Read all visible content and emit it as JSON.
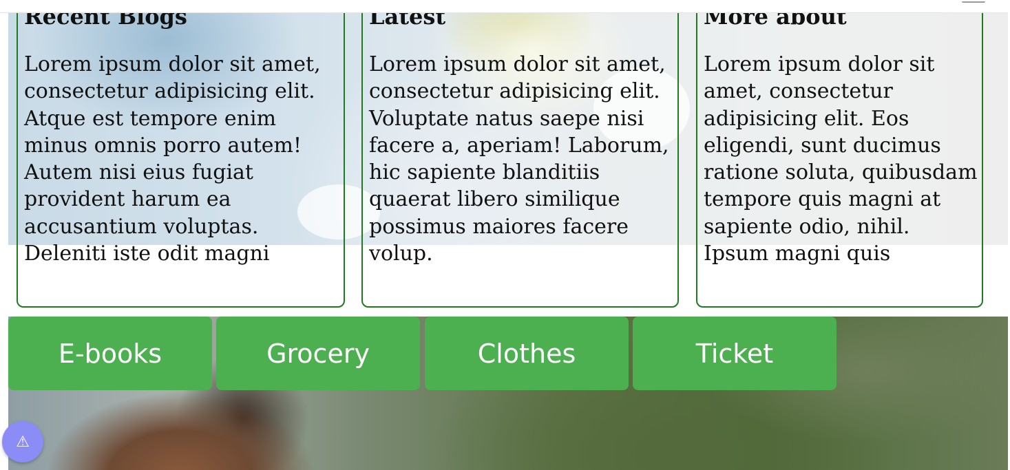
{
  "blogs": [
    {
      "title": "Recent Blogs",
      "text": "Lorem ipsum dolor sit amet, consectetur adipisicing elit. Atque est tempore enim minus omnis porro autem! Autem nisi eius fugiat provident harum ea accusantium voluptas. Deleniti iste odit magni"
    },
    {
      "title": "Latest",
      "text": "Lorem ipsum dolor sit amet, consectetur adipisicing elit. Voluptate natus saepe nisi facere a, aperiam! Laborum, hic sapiente blanditiis quaerat libero similique possimus maiores facere volup."
    },
    {
      "title": "More about",
      "text": "Lorem ipsum dolor sit amet, consectetur adipisicing elit. Eos eligendi, sunt ducimus ratione soluta, quibusdam tempore quis magni at sapiente odio, nihil. Ipsum magni quis"
    }
  ],
  "nav": {
    "buttons": [
      "E-books",
      "Grocery",
      "Clothes",
      "Ticket"
    ]
  },
  "fab": {
    "icon": "warning-icon",
    "glyph": "⚠"
  },
  "colors": {
    "card_border": "#1f7a1f",
    "button_bg": "#4caf50",
    "button_text": "#ffffff",
    "fab_bg": "#8c8cf7"
  }
}
